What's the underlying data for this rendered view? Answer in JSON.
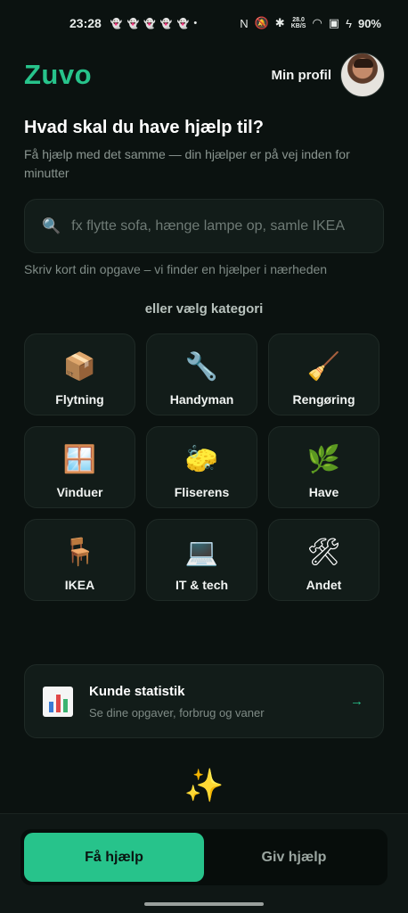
{
  "statusbar": {
    "time": "23:28",
    "notifications": [
      "snapchat-icon",
      "snapchat-icon",
      "snapchat-icon",
      "snapchat-icon",
      "snapchat-icon"
    ],
    "net_speed_value": "28.0",
    "net_speed_unit": "KB/S",
    "battery": "90%"
  },
  "header": {
    "logo": "Zuvo",
    "profile_label": "Min profil"
  },
  "intro": {
    "headline": "Hvad skal du have hjælp til?",
    "subline": "Få hjælp med det samme — din hjælper er på vej inden for minutter"
  },
  "search": {
    "placeholder": "fx flytte sofa, hænge lampe op, samle IKEA",
    "value": "",
    "hint": "Skriv kort din opgave – vi finder en hjælper i nærheden"
  },
  "categories": {
    "heading": "eller vælg kategori",
    "items": [
      {
        "label": "Flytning",
        "icon": "📦",
        "icon_name": "package-icon"
      },
      {
        "label": "Handyman",
        "icon": "🔧",
        "icon_name": "wrench-icon"
      },
      {
        "label": "Rengøring",
        "icon": "🧹",
        "icon_name": "broom-icon"
      },
      {
        "label": "Vinduer",
        "icon": "🪟",
        "icon_name": "window-icon"
      },
      {
        "label": "Fliserens",
        "icon": "🧽",
        "icon_name": "sponge-icon"
      },
      {
        "label": "Have",
        "icon": "🌿",
        "icon_name": "herb-icon"
      },
      {
        "label": "IKEA",
        "icon": "🪑",
        "icon_name": "chair-icon"
      },
      {
        "label": "IT & tech",
        "icon": "💻",
        "icon_name": "laptop-icon"
      },
      {
        "label": "Andet",
        "icon": "🛠",
        "icon_name": "tools-icon"
      }
    ]
  },
  "stats_card": {
    "title": "Kunde statistik",
    "subtitle": "Se dine opgaver, forbrug og vaner",
    "arrow": "→",
    "icon_name": "bar-chart-icon"
  },
  "sparkle": "✨",
  "bottom_nav": {
    "get_help": "Få hjælp",
    "give_help": "Giv hjælp",
    "active": "get_help"
  },
  "colors": {
    "accent": "#27c38b",
    "background": "#0b1210",
    "card": "#121c19"
  }
}
